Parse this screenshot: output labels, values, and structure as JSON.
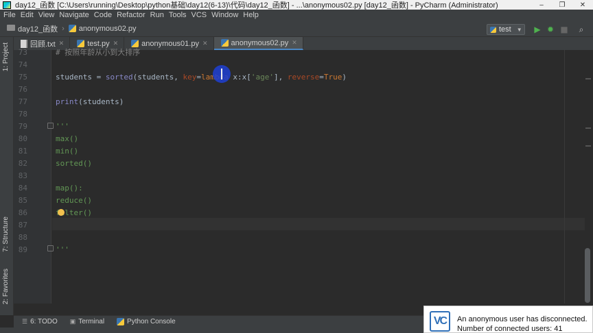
{
  "window": {
    "title": "day12_函数 [C:\\Users\\running\\Desktop\\python基础\\day12(6-13)\\代码\\day12_函数] - ...\\anonymous02.py [day12_函数] - PyCharm (Administrator)",
    "minimize": "–",
    "restore": "❐",
    "close": "✕"
  },
  "menu": [
    "File",
    "Edit",
    "View",
    "Navigate",
    "Code",
    "Refactor",
    "Run",
    "Tools",
    "VCS",
    "Window",
    "Help"
  ],
  "breadcrumb": {
    "project": "day12_函数",
    "file": "anonymous02.py",
    "separator": "›"
  },
  "run_config": {
    "name": "test"
  },
  "tabs": [
    {
      "label": "回顾.txt"
    },
    {
      "label": "test.py"
    },
    {
      "label": "anonymous01.py"
    },
    {
      "label": "anonymous02.py"
    }
  ],
  "side_tabs": {
    "project": "1: Project",
    "structure": "7: Structure",
    "favorites": "2: Favorites"
  },
  "line_numbers": [
    "73",
    "74",
    "75",
    "76",
    "77",
    "78",
    "79",
    "80",
    "81",
    "82",
    "83",
    "84",
    "85",
    "86",
    "87",
    "88",
    "89"
  ],
  "code": {
    "l73_comment": "# 按照年龄从小到大排序",
    "l75_var": "students",
    "l75_eq": " = ",
    "l75_fn": "sorted",
    "l75_open": "(students, ",
    "l75_key": "key",
    "l75_eq2": "=",
    "l75_lambda": "lambda",
    "l75_x": " x:x[",
    "l75_str": "'age'",
    "l75_close": "], ",
    "l75_rev": "reverse",
    "l75_eq3": "=",
    "l75_true": "True",
    "l75_end": ")",
    "l77_fn": "print",
    "l77_rest": "(students)",
    "l79": "'''",
    "l80": "max()",
    "l81": "min()",
    "l82": "sorted()",
    "l84": "map():",
    "l85": "reduce()",
    "l86": "filter()",
    "l89": "'''"
  },
  "bottom_tabs": {
    "todo": "6: TODO",
    "terminal": "Terminal",
    "console": "Python Console"
  },
  "notification": {
    "logo": "VC",
    "line1": "An anonymous user has disconnected.",
    "line2": "Number of connected users: 41"
  }
}
